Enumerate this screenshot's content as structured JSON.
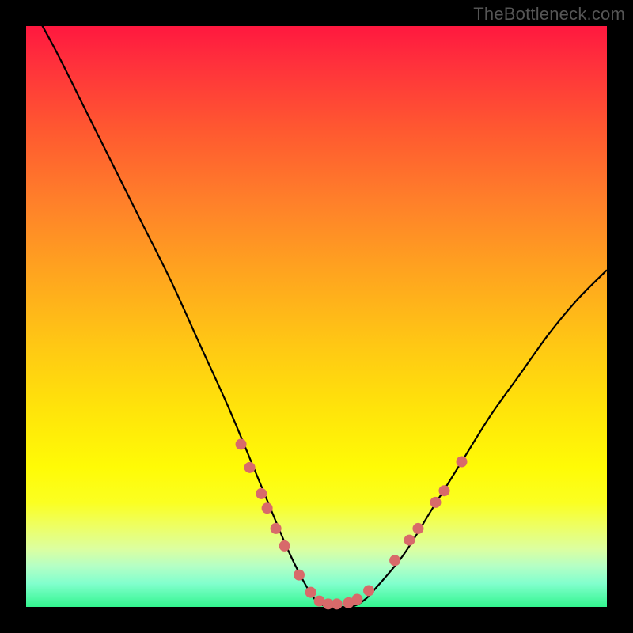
{
  "watermark": "TheBottleneck.com",
  "colors": {
    "frame": "#000000",
    "curve": "#000000",
    "marker_fill": "#d86a6a",
    "marker_stroke": "#d86a6a"
  },
  "chart_data": {
    "type": "line",
    "title": "",
    "xlabel": "",
    "ylabel": "",
    "xlim": [
      0,
      100
    ],
    "ylim": [
      0,
      100
    ],
    "grid": false,
    "series": [
      {
        "name": "bottleneck-curve",
        "x": [
          0,
          5,
          10,
          15,
          20,
          25,
          30,
          35,
          40,
          45,
          48,
          50,
          52,
          54,
          56,
          58,
          60,
          65,
          70,
          75,
          80,
          85,
          90,
          95,
          100
        ],
        "values": [
          105,
          96,
          86,
          76,
          66,
          56,
          45,
          34,
          22,
          10,
          4,
          1,
          0,
          0,
          0,
          1,
          3,
          9,
          17,
          25,
          33,
          40,
          47,
          53,
          58
        ]
      }
    ],
    "markers": [
      {
        "x": 37.0,
        "y": 28.0
      },
      {
        "x": 38.5,
        "y": 24.0
      },
      {
        "x": 40.5,
        "y": 19.5
      },
      {
        "x": 41.5,
        "y": 17.0
      },
      {
        "x": 43.0,
        "y": 13.5
      },
      {
        "x": 44.5,
        "y": 10.5
      },
      {
        "x": 47.0,
        "y": 5.5
      },
      {
        "x": 49.0,
        "y": 2.5
      },
      {
        "x": 50.5,
        "y": 1.0
      },
      {
        "x": 52.0,
        "y": 0.5
      },
      {
        "x": 53.5,
        "y": 0.5
      },
      {
        "x": 55.5,
        "y": 0.7
      },
      {
        "x": 57.0,
        "y": 1.3
      },
      {
        "x": 59.0,
        "y": 2.8
      },
      {
        "x": 63.5,
        "y": 8.0
      },
      {
        "x": 66.0,
        "y": 11.5
      },
      {
        "x": 67.5,
        "y": 13.5
      },
      {
        "x": 70.5,
        "y": 18.0
      },
      {
        "x": 72.0,
        "y": 20.0
      },
      {
        "x": 75.0,
        "y": 25.0
      }
    ]
  }
}
